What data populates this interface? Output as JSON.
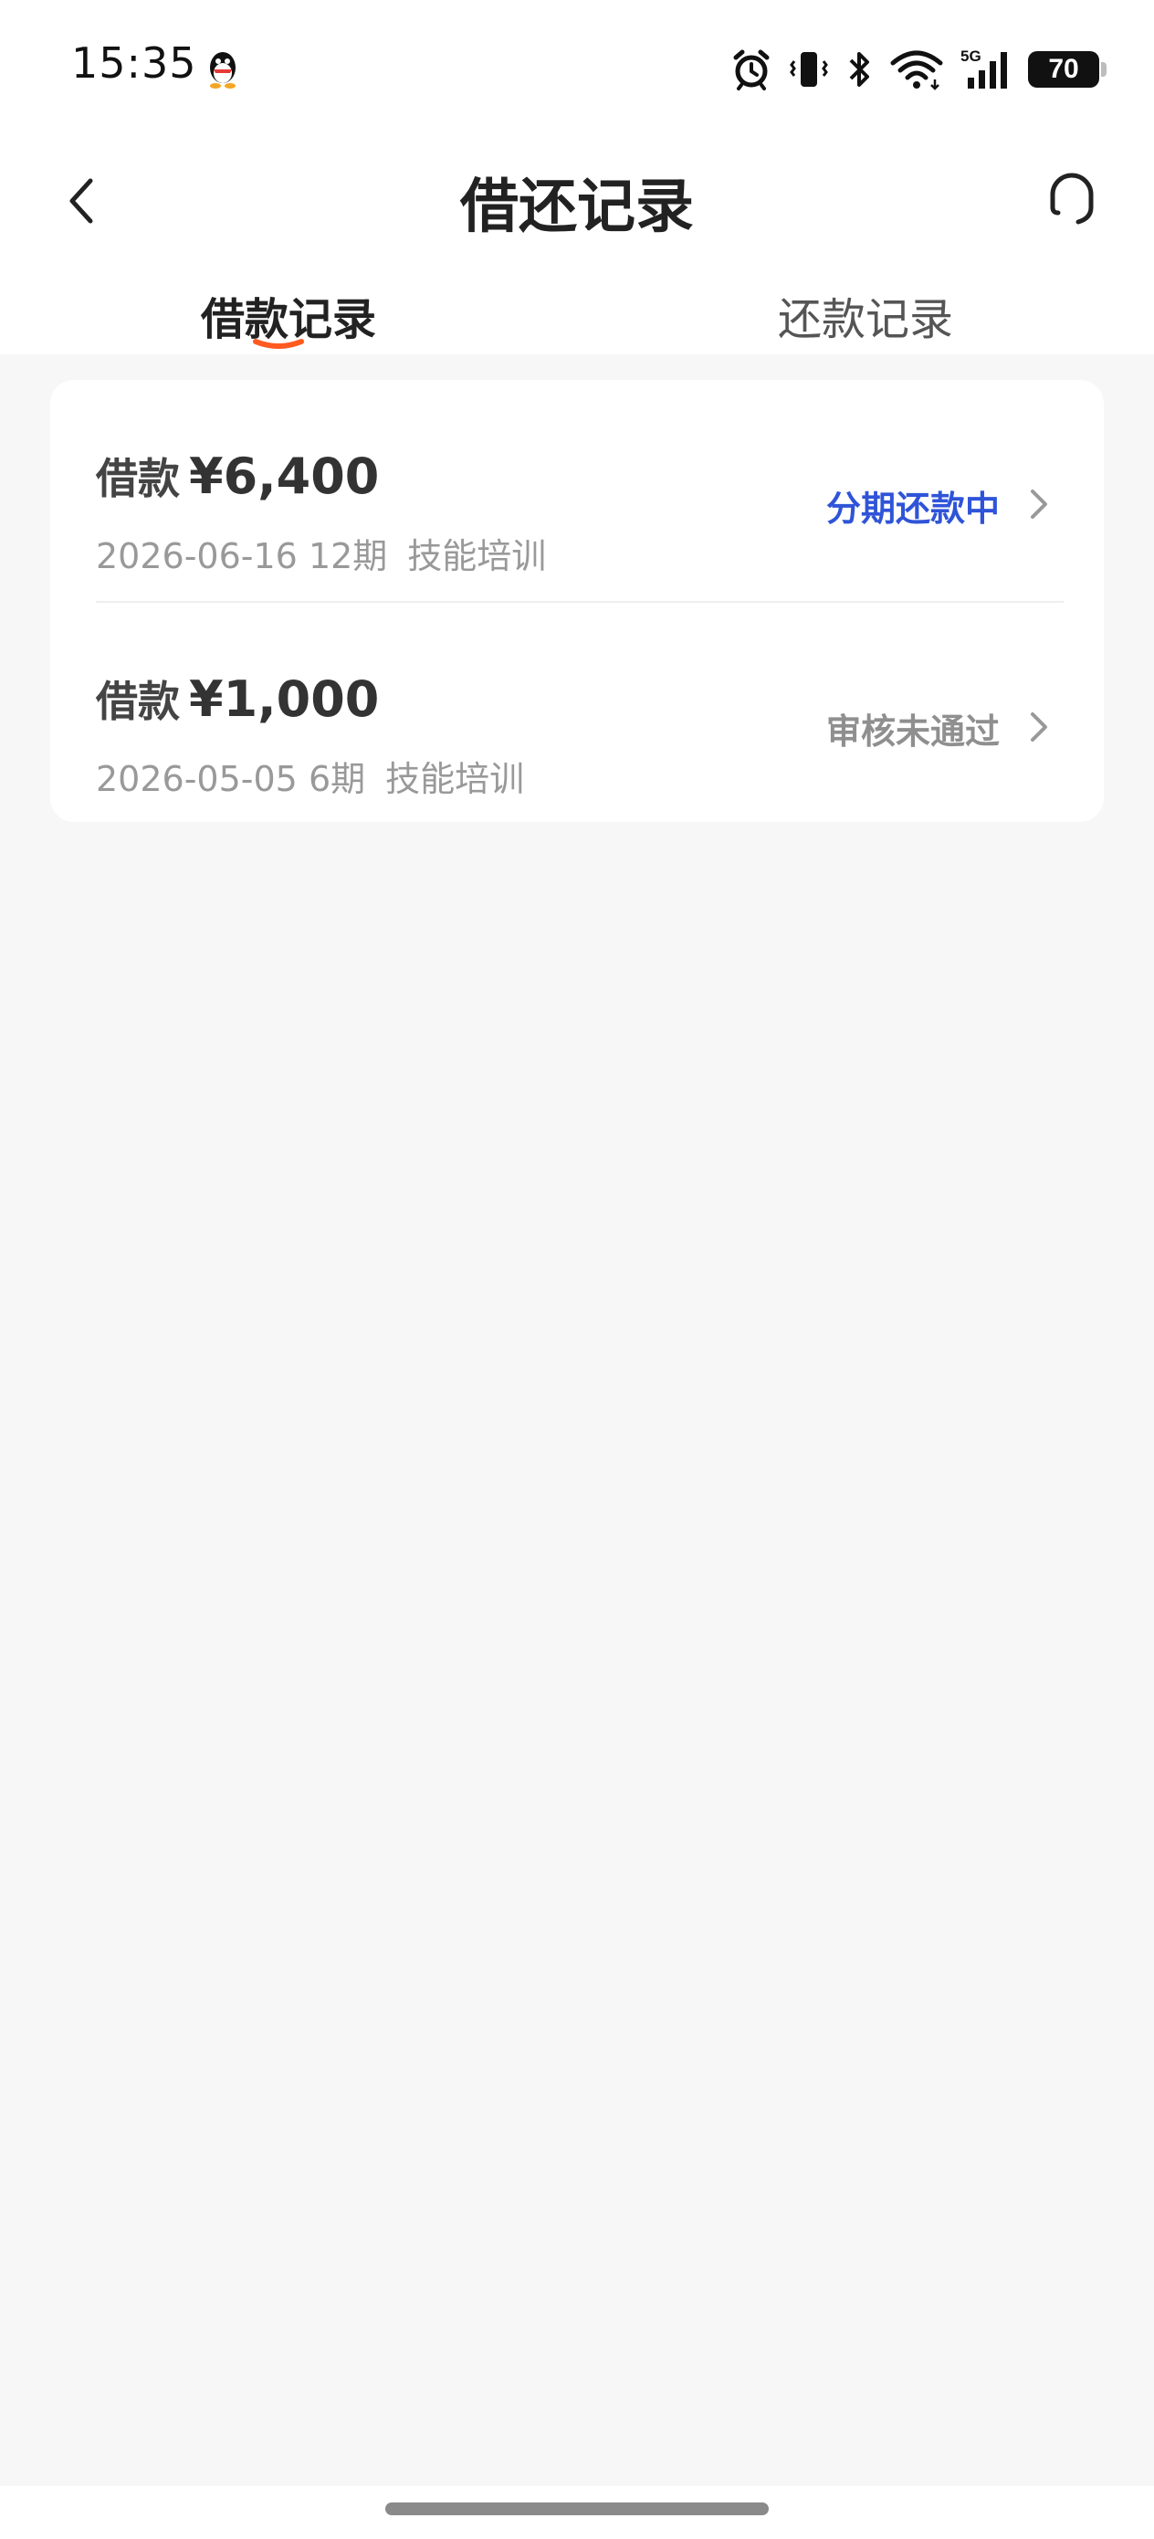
{
  "status_bar": {
    "time": "15:35",
    "battery": "70",
    "network": "5G"
  },
  "nav": {
    "title": "借还记录"
  },
  "tabs": [
    {
      "label": "借款记录",
      "active": true
    },
    {
      "label": "还款记录",
      "active": false
    }
  ],
  "loans": [
    {
      "label": "借款",
      "amount": "¥6,400",
      "date": "2026-06-16",
      "periods": "12期",
      "purpose": "技能培训",
      "status": "分期还款中",
      "status_color": "#2f54d8"
    },
    {
      "label": "借款",
      "amount": "¥1,000",
      "date": "2026-05-05",
      "periods": "6期",
      "purpose": "技能培训",
      "status": "审核未通过",
      "status_color": "#8f8f8f"
    }
  ],
  "colors": {
    "accent_orange": "#ff5a1f",
    "status_blue": "#2f54d8",
    "page_bg": "#f7f7f7"
  }
}
